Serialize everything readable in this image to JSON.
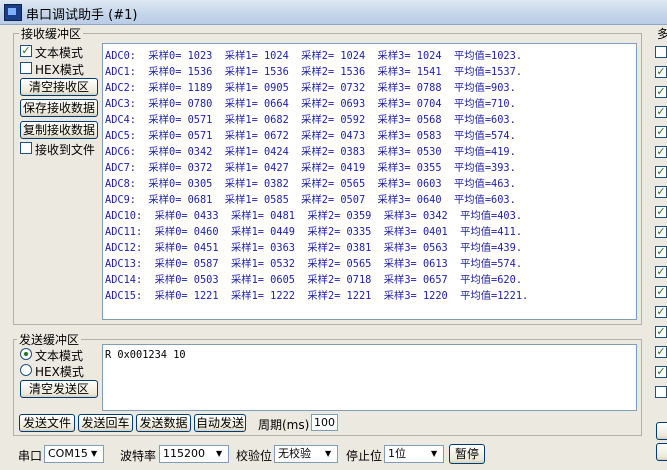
{
  "window": {
    "title": "串口调试助手 (#1)"
  },
  "receive": {
    "group_label": "接收缓冲区",
    "text_mode_label": "文本模式",
    "text_mode_checked": true,
    "hex_mode_label": "HEX模式",
    "hex_mode_checked": false,
    "clear_button": "清空接收区",
    "save_button": "保存接收数据",
    "copy_button": "复制接收数据",
    "to_file_label": "接收到文件",
    "to_file_checked": false,
    "lines": [
      "ADC0:  采样0= 1023  采样1= 1024  采样2= 1024  采样3= 1024  平均值=1023.",
      "ADC1:  采样0= 1536  采样1= 1536  采样2= 1536  采样3= 1541  平均值=1537.",
      "ADC2:  采样0= 1189  采样1= 0905  采样2= 0732  采样3= 0788  平均值=903.",
      "ADC3:  采样0= 0780  采样1= 0664  采样2= 0693  采样3= 0704  平均值=710.",
      "ADC4:  采样0= 0571  采样1= 0682  采样2= 0592  采样3= 0568  平均值=603.",
      "ADC5:  采样0= 0571  采样1= 0672  采样2= 0473  采样3= 0583  平均值=574.",
      "ADC6:  采样0= 0342  采样1= 0424  采样2= 0383  采样3= 0530  平均值=419.",
      "ADC7:  采样0= 0372  采样1= 0427  采样2= 0419  采样3= 0355  平均值=393.",
      "ADC8:  采样0= 0305  采样1= 0382  采样2= 0565  采样3= 0603  平均值=463.",
      "ADC9:  采样0= 0681  采样1= 0585  采样2= 0507  采样3= 0640  平均值=603.",
      "ADC10:  采样0= 0433  采样1= 0481  采样2= 0359  采样3= 0342  平均值=403.",
      "ADC11:  采样0= 0460  采样1= 0449  采样2= 0335  采样3= 0401  平均值=411.",
      "ADC12:  采样0= 0451  采样1= 0363  采样2= 0381  采样3= 0563  平均值=439.",
      "ADC13:  采样0= 0587  采样1= 0532  采样2= 0565  采样3= 0613  平均值=574.",
      "ADC14:  采样0= 0503  采样1= 0605  采样2= 0718  采样3= 0657  平均值=620.",
      "ADC15:  采样0= 1221  采样1= 1222  采样2= 1221  采样3= 1220  平均值=1221."
    ]
  },
  "send": {
    "group_label": "发送缓冲区",
    "text_mode_label": "文本模式",
    "hex_mode_label": "HEX模式",
    "selected_mode": "text",
    "clear_button": "清空发送区",
    "content": "R 0x001234 10",
    "send_file_button": "发送文件",
    "send_crlf_button": "发送回车",
    "send_data_button": "发送数据",
    "auto_send_button": "自动发送",
    "period_label": "周期(ms)",
    "period_value": "100"
  },
  "port_bar": {
    "port_label": "串口",
    "port_value": "COM15",
    "baud_label": "波特率",
    "baud_value": "115200",
    "parity_label": "校验位",
    "parity_value": "无校验",
    "stopbits_label": "停止位",
    "stopbits_value": "1位",
    "pause_button": "暂停"
  },
  "right_panel": {
    "label_partial": "多",
    "checkbox_states": [
      false,
      true,
      true,
      true,
      true,
      true,
      true,
      true,
      true,
      true,
      true,
      true,
      true,
      true,
      true,
      true,
      true,
      false
    ]
  },
  "colors": {
    "receive_text": "#1d1da6",
    "checkmark": "#217321"
  }
}
